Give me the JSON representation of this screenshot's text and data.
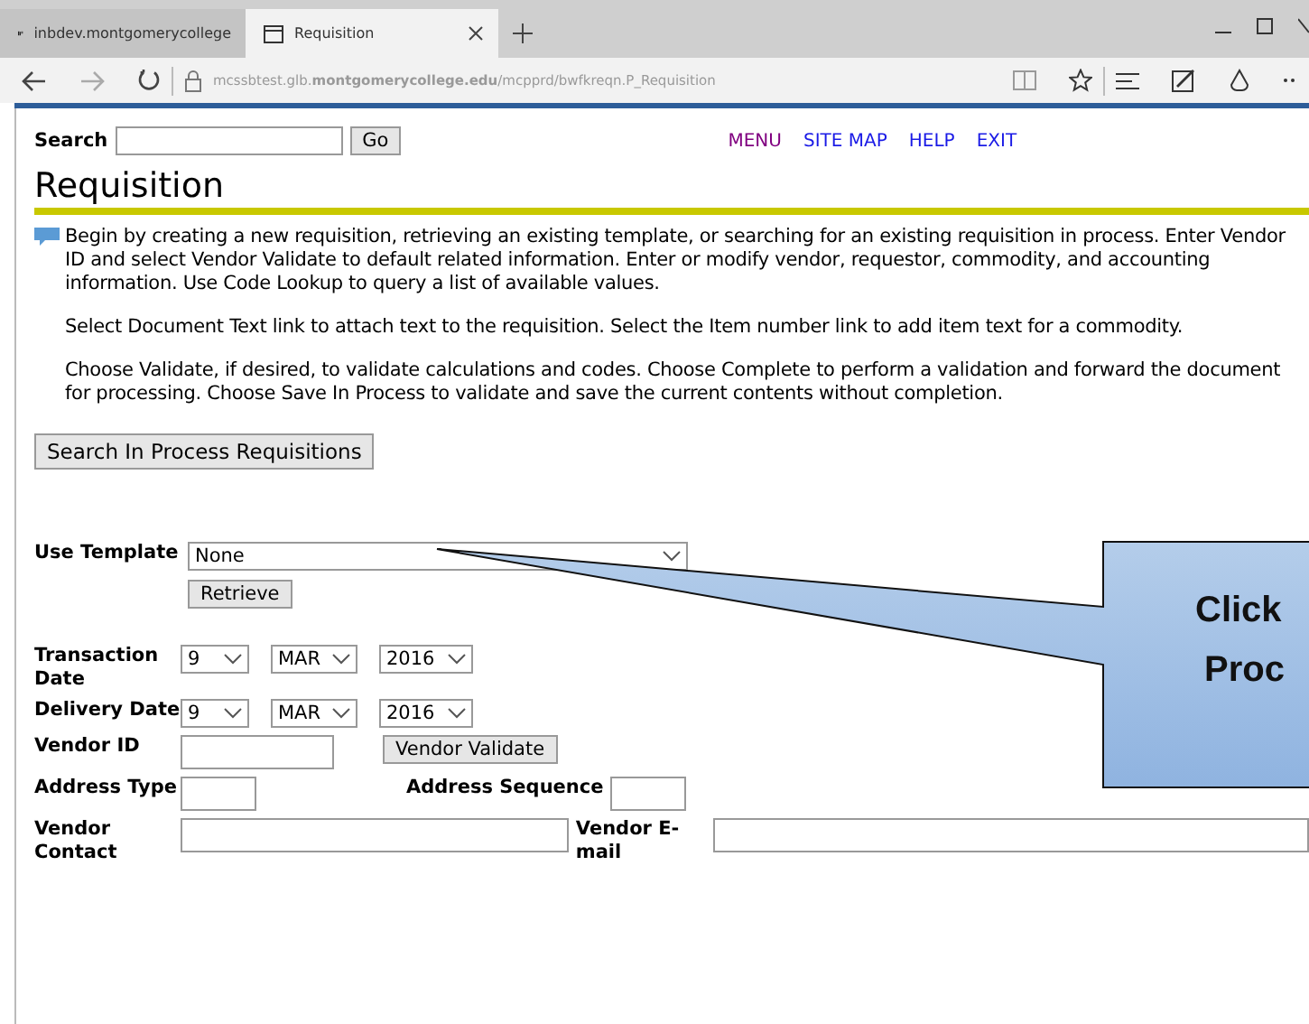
{
  "browser": {
    "tabs": [
      {
        "label": "inbdev.montgomerycollege",
        "selected": false
      },
      {
        "label": "Requisition",
        "selected": true
      }
    ],
    "url": "mcssbtest.glb.**montgomerycollege.edu**/mcpprd/bwfkreqn.P_Requisition"
  },
  "search": {
    "label": "Search",
    "button": "Go"
  },
  "nav_links": [
    {
      "label": "MENU",
      "visited": true
    },
    {
      "label": "SITE MAP",
      "visited": false
    },
    {
      "label": "HELP",
      "visited": false
    },
    {
      "label": "EXIT",
      "visited": false
    }
  ],
  "title": "Requisition",
  "paragraphs": [
    "Begin by creating a new requisition, retrieving an existing template, or searching for an existing requisition in process. Enter Vendor ID and select Vendor Validate to default related information. Enter or modify vendor, requestor, commodity, and accounting information. Use Code Lookup to query a list of available values.",
    "Select Document Text link to attach text to the requisition. Select the Item number link to add item text for a commodity.",
    "Choose Validate, if desired, to validate calculations and codes. Choose Complete to perform a validation and forward the document for processing. Choose Save In Process to validate and save the current contents without completion."
  ],
  "search_in_process_button": "Search In Process Requisitions",
  "template": {
    "label": "Use Template",
    "value": "None",
    "button": "Retrieve"
  },
  "dates": [
    {
      "label": "Transaction Date",
      "day": "9",
      "month": "MAR",
      "year": "2016"
    },
    {
      "label": "Delivery Date",
      "day": "9",
      "month": "MAR",
      "year": "2016"
    }
  ],
  "vendor_id": {
    "label": "Vendor ID",
    "button": "Vendor Validate"
  },
  "address": {
    "type_label": "Address Type",
    "sequence_label": "Address Sequence"
  },
  "contact": {
    "contact_label": "Vendor Contact",
    "email_label": "Vendor E-mail"
  },
  "callout": {
    "lines": [
      "Click",
      "Proc"
    ]
  }
}
